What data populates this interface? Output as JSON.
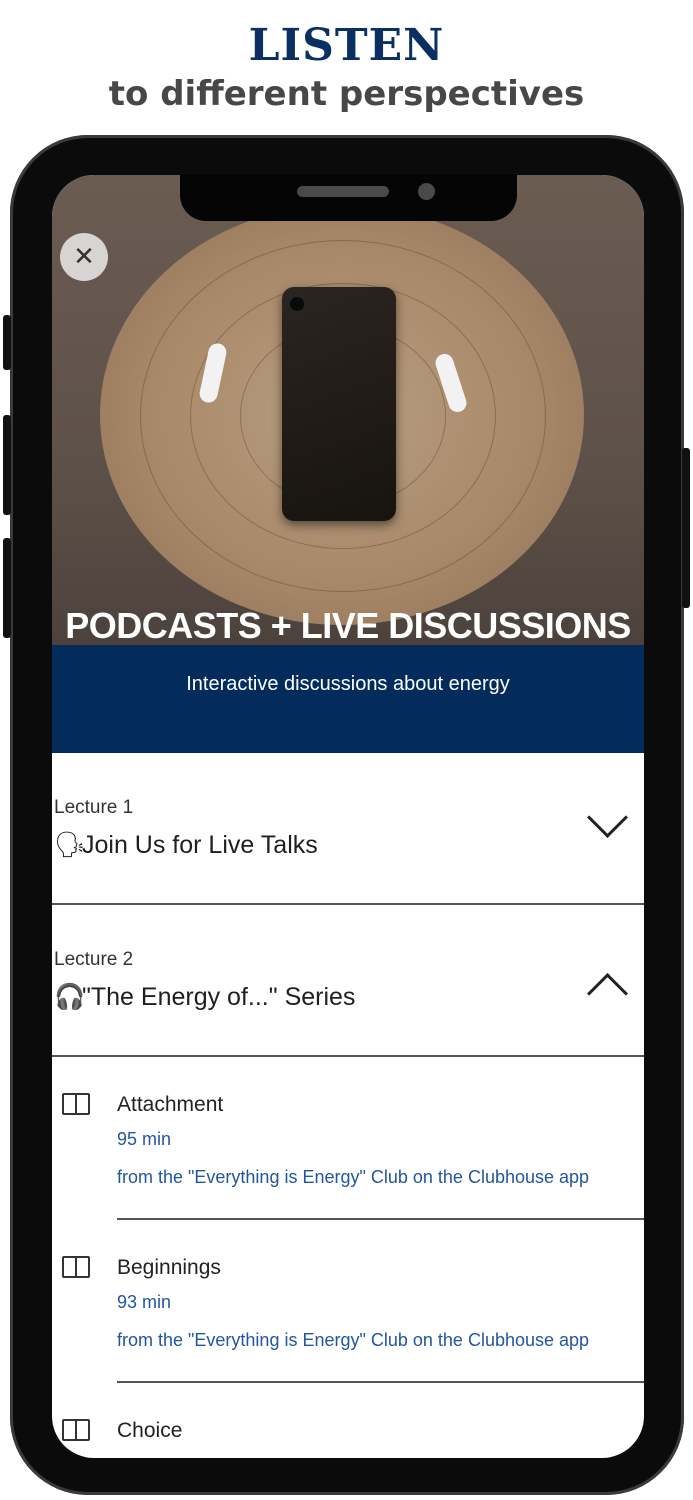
{
  "header": {
    "headline": "LISTEN",
    "subheadline": "to different perspectives"
  },
  "hero": {
    "title": "PODCASTS + LIVE DISCUSSIONS",
    "subtitle": "Interactive discussions about energy",
    "close_icon": "close-icon"
  },
  "lectures": [
    {
      "label": "Lecture 1",
      "emoji": "🗣",
      "title": "Join Us for Live Talks",
      "state": "collapsed",
      "chevron_icon": "chevron-down-icon"
    },
    {
      "label": "Lecture 2",
      "emoji": "🎧",
      "title": "\"The Energy of...\" Series",
      "state": "expanded",
      "chevron_icon": "chevron-up-icon"
    }
  ],
  "items": [
    {
      "icon": "book-icon",
      "title": "Attachment",
      "duration": "95 min",
      "source": "from the \"Everything is Energy\" Club on the Clubhouse app"
    },
    {
      "icon": "book-icon",
      "title": "Beginnings",
      "duration": "93 min",
      "source": "from the \"Everything is Energy\" Club on the Clubhouse app"
    },
    {
      "icon": "book-icon",
      "title": "Choice",
      "duration": "",
      "source": ""
    }
  ],
  "colors": {
    "headline": "#0a2f63",
    "banner": "#032c5c",
    "link": "#2356a0"
  }
}
